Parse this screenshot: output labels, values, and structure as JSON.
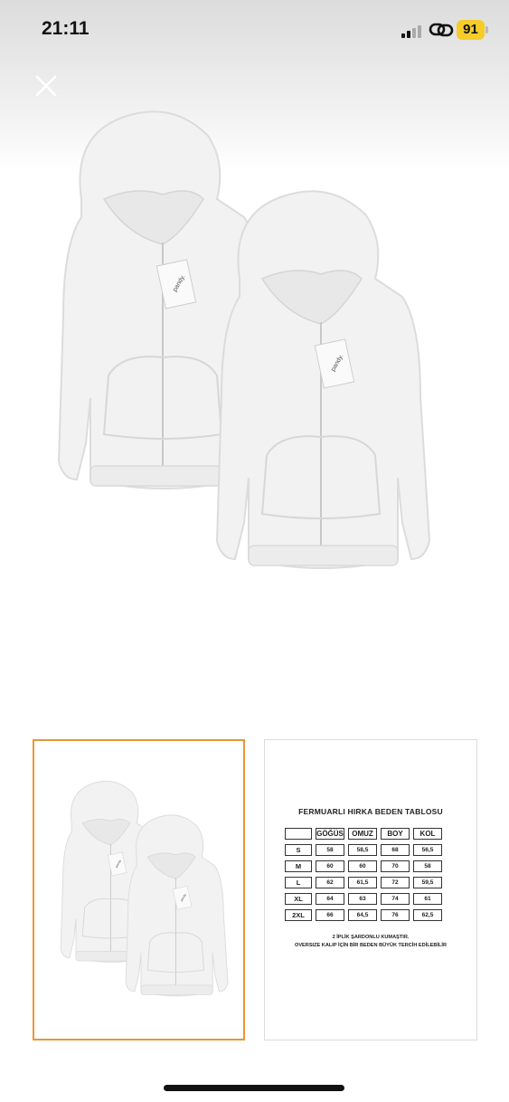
{
  "status_bar": {
    "time": "21:11",
    "battery_level": "91",
    "signal_icon": "cellular-signal-icon",
    "link_icon": "link-icon"
  },
  "hero": {
    "close_icon": "close-icon",
    "image": "two-white-zip-hoodies",
    "tag_text": "pandy."
  },
  "colors": {
    "selected_border": "#e8963a",
    "battery": "#f5cc2a",
    "hoodie": "#f2f2f2"
  },
  "size_chart": {
    "title": "FERMUARLI HIRKA BEDEN TABLOSU",
    "columns": [
      "",
      "GÖĞÜS",
      "OMUZ",
      "BOY",
      "KOL"
    ],
    "rows": [
      [
        "S",
        "58",
        "58,5",
        "68",
        "56,5"
      ],
      [
        "M",
        "60",
        "60",
        "70",
        "58"
      ],
      [
        "L",
        "62",
        "61,5",
        "72",
        "59,5"
      ],
      [
        "XL",
        "64",
        "63",
        "74",
        "61"
      ],
      [
        "2XL",
        "66",
        "64,5",
        "76",
        "62,5"
      ]
    ],
    "note_1": "2 İPLİK ŞARDONLU KUMAŞTIR.",
    "note_2": "OVERSIZE KALIP İÇİN BİR BEDEN BÜYÜK TERCİH EDİLEBİLİR"
  }
}
